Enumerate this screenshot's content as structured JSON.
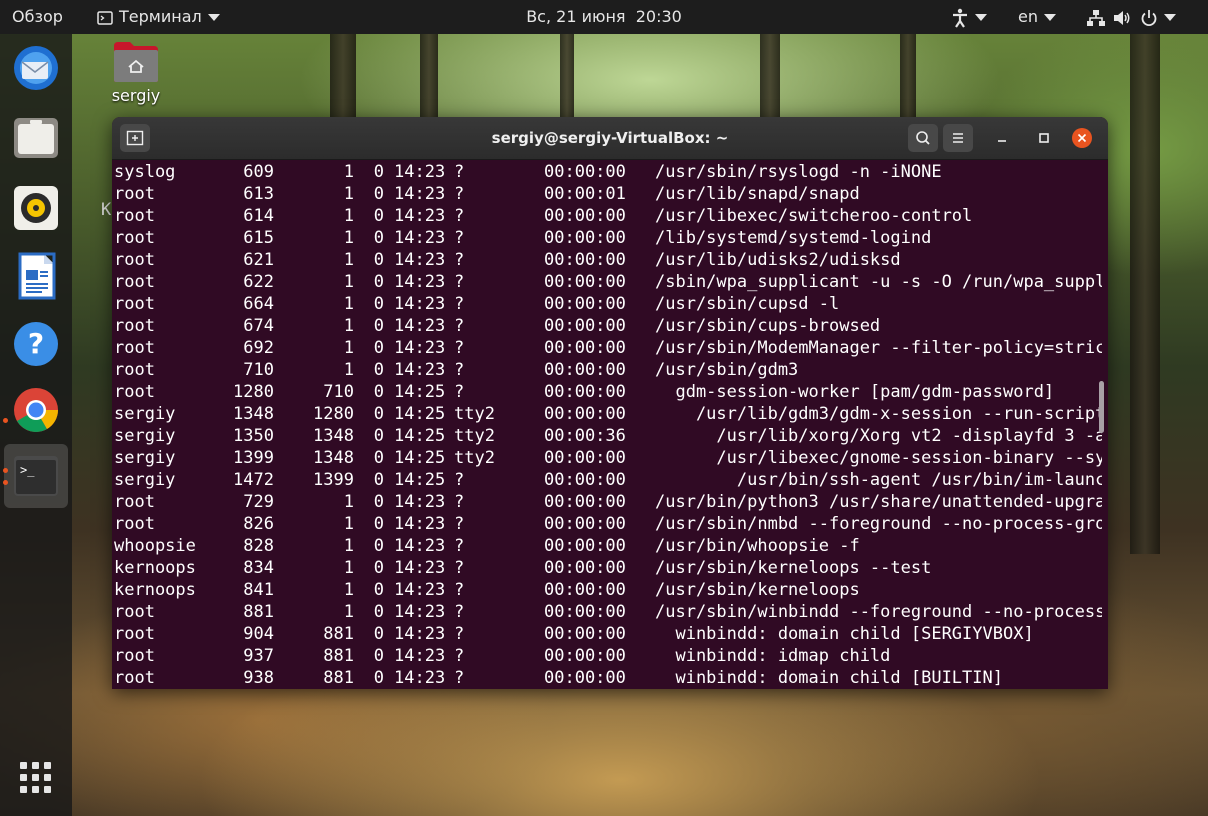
{
  "topbar": {
    "overview": "Обзор",
    "app_menu": "Терминал",
    "clock": "Вс, 21 июня  20:30",
    "language": "en"
  },
  "desktop": {
    "home_folder_label": "sergiy",
    "stray_char": "K"
  },
  "dock": {
    "items": [
      {
        "name": "thunderbird-icon"
      },
      {
        "name": "files-icon"
      },
      {
        "name": "rhythmbox-icon"
      },
      {
        "name": "libreoffice-writer-icon"
      },
      {
        "name": "help-icon"
      },
      {
        "name": "chrome-icon"
      },
      {
        "name": "terminal-icon"
      }
    ]
  },
  "terminal": {
    "title": "sergiy@sergiy-VirtualBox: ~",
    "accent": "#e95420",
    "background": "#300a24",
    "rows": [
      {
        "user": "syslog",
        "pid": "609",
        "ppid": "1",
        "c": "0",
        "stime": "14:23",
        "tty": "?",
        "time": "00:00:00",
        "cmd": "/usr/sbin/rsyslogd -n -iNONE"
      },
      {
        "user": "root",
        "pid": "613",
        "ppid": "1",
        "c": "0",
        "stime": "14:23",
        "tty": "?",
        "time": "00:00:01",
        "cmd": "/usr/lib/snapd/snapd"
      },
      {
        "user": "root",
        "pid": "614",
        "ppid": "1",
        "c": "0",
        "stime": "14:23",
        "tty": "?",
        "time": "00:00:00",
        "cmd": "/usr/libexec/switcheroo-control"
      },
      {
        "user": "root",
        "pid": "615",
        "ppid": "1",
        "c": "0",
        "stime": "14:23",
        "tty": "?",
        "time": "00:00:00",
        "cmd": "/lib/systemd/systemd-logind"
      },
      {
        "user": "root",
        "pid": "621",
        "ppid": "1",
        "c": "0",
        "stime": "14:23",
        "tty": "?",
        "time": "00:00:00",
        "cmd": "/usr/lib/udisks2/udisksd"
      },
      {
        "user": "root",
        "pid": "622",
        "ppid": "1",
        "c": "0",
        "stime": "14:23",
        "tty": "?",
        "time": "00:00:00",
        "cmd": "/sbin/wpa_supplicant -u -s -O /run/wpa_suppl"
      },
      {
        "user": "root",
        "pid": "664",
        "ppid": "1",
        "c": "0",
        "stime": "14:23",
        "tty": "?",
        "time": "00:00:00",
        "cmd": "/usr/sbin/cupsd -l"
      },
      {
        "user": "root",
        "pid": "674",
        "ppid": "1",
        "c": "0",
        "stime": "14:23",
        "tty": "?",
        "time": "00:00:00",
        "cmd": "/usr/sbin/cups-browsed"
      },
      {
        "user": "root",
        "pid": "692",
        "ppid": "1",
        "c": "0",
        "stime": "14:23",
        "tty": "?",
        "time": "00:00:00",
        "cmd": "/usr/sbin/ModemManager --filter-policy=stric"
      },
      {
        "user": "root",
        "pid": "710",
        "ppid": "1",
        "c": "0",
        "stime": "14:23",
        "tty": "?",
        "time": "00:00:00",
        "cmd": "/usr/sbin/gdm3"
      },
      {
        "user": "root",
        "pid": "1280",
        "ppid": "710",
        "c": "0",
        "stime": "14:25",
        "tty": "?",
        "time": "00:00:00",
        "cmd": "  gdm-session-worker [pam/gdm-password]"
      },
      {
        "user": "sergiy",
        "pid": "1348",
        "ppid": "1280",
        "c": "0",
        "stime": "14:25",
        "tty": "tty2",
        "time": "00:00:00",
        "cmd": "    /usr/lib/gdm3/gdm-x-session --run-script"
      },
      {
        "user": "sergiy",
        "pid": "1350",
        "ppid": "1348",
        "c": "0",
        "stime": "14:25",
        "tty": "tty2",
        "time": "00:00:36",
        "cmd": "      /usr/lib/xorg/Xorg vt2 -displayfd 3 -a"
      },
      {
        "user": "sergiy",
        "pid": "1399",
        "ppid": "1348",
        "c": "0",
        "stime": "14:25",
        "tty": "tty2",
        "time": "00:00:00",
        "cmd": "      /usr/libexec/gnome-session-binary --sy"
      },
      {
        "user": "sergiy",
        "pid": "1472",
        "ppid": "1399",
        "c": "0",
        "stime": "14:25",
        "tty": "?",
        "time": "00:00:00",
        "cmd": "        /usr/bin/ssh-agent /usr/bin/im-launc"
      },
      {
        "user": "root",
        "pid": "729",
        "ppid": "1",
        "c": "0",
        "stime": "14:23",
        "tty": "?",
        "time": "00:00:00",
        "cmd": "/usr/bin/python3 /usr/share/unattended-upgra"
      },
      {
        "user": "root",
        "pid": "826",
        "ppid": "1",
        "c": "0",
        "stime": "14:23",
        "tty": "?",
        "time": "00:00:00",
        "cmd": "/usr/sbin/nmbd --foreground --no-process-gro"
      },
      {
        "user": "whoopsie",
        "pid": "828",
        "ppid": "1",
        "c": "0",
        "stime": "14:23",
        "tty": "?",
        "time": "00:00:00",
        "cmd": "/usr/bin/whoopsie -f"
      },
      {
        "user": "kernoops",
        "pid": "834",
        "ppid": "1",
        "c": "0",
        "stime": "14:23",
        "tty": "?",
        "time": "00:00:00",
        "cmd": "/usr/sbin/kerneloops --test"
      },
      {
        "user": "kernoops",
        "pid": "841",
        "ppid": "1",
        "c": "0",
        "stime": "14:23",
        "tty": "?",
        "time": "00:00:00",
        "cmd": "/usr/sbin/kerneloops"
      },
      {
        "user": "root",
        "pid": "881",
        "ppid": "1",
        "c": "0",
        "stime": "14:23",
        "tty": "?",
        "time": "00:00:00",
        "cmd": "/usr/sbin/winbindd --foreground --no-process"
      },
      {
        "user": "root",
        "pid": "904",
        "ppid": "881",
        "c": "0",
        "stime": "14:23",
        "tty": "?",
        "time": "00:00:00",
        "cmd": "  winbindd: domain child [SERGIYVBOX]"
      },
      {
        "user": "root",
        "pid": "937",
        "ppid": "881",
        "c": "0",
        "stime": "14:23",
        "tty": "?",
        "time": "00:00:00",
        "cmd": "  winbindd: idmap child"
      },
      {
        "user": "root",
        "pid": "938",
        "ppid": "881",
        "c": "0",
        "stime": "14:23",
        "tty": "?",
        "time": "00:00:00",
        "cmd": "  winbindd: domain child [BUILTIN]"
      }
    ]
  }
}
